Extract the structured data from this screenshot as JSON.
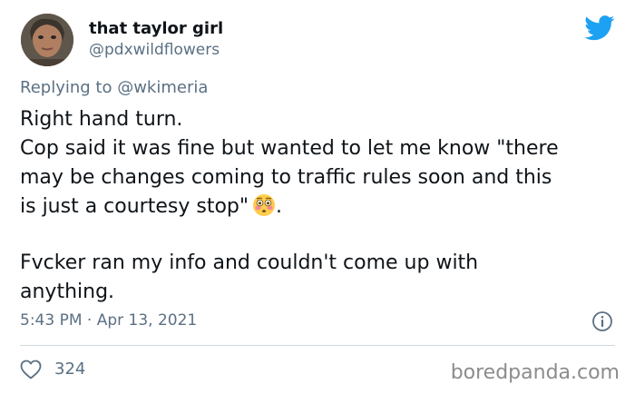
{
  "user": {
    "display_name": "that taylor girl",
    "handle": "@pdxwildflowers"
  },
  "reply": {
    "prefix": "Replying to ",
    "mention": "@wkimeria"
  },
  "tweet": {
    "lines": [
      "Right hand turn.",
      "Cop said it was fine but wanted to let me know \"there",
      "may be changes coming to traffic rules soon and this",
      "is just a courtesy stop\"",
      "Fvcker ran my info and couldn't come up with",
      "anything."
    ],
    "emoji": "flushed-face",
    "after_emoji": "."
  },
  "meta": {
    "timestamp": "5:43 PM · Apr 13, 2021"
  },
  "stats": {
    "likes": "324"
  },
  "watermark": "boredpanda.com",
  "colors": {
    "twitter_blue": "#1da1f2",
    "secondary_text": "#5b7083",
    "divider": "#cfd9de"
  },
  "icons": {
    "brand": "twitter-bird-icon",
    "info": "info-icon",
    "like": "heart-icon"
  }
}
